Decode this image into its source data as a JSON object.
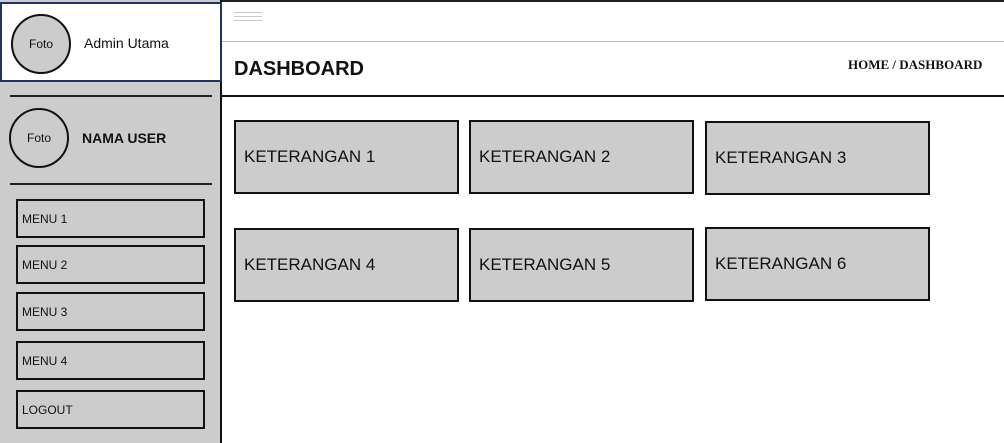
{
  "brand": {
    "avatar_text": "Foto",
    "name": "Admin Utama"
  },
  "user": {
    "avatar_text": "Foto",
    "name": "NAMA USER"
  },
  "sidebar": {
    "menu": [
      {
        "label": "MENU 1"
      },
      {
        "label": "MENU 2"
      },
      {
        "label": "MENU 3"
      },
      {
        "label": "MENU 4"
      },
      {
        "label": "LOGOUT"
      }
    ]
  },
  "header": {
    "title": "DASHBOARD",
    "breadcrumb": "HOME / DASHBOARD"
  },
  "cards": [
    {
      "label": "KETERANGAN 1"
    },
    {
      "label": "KETERANGAN 2"
    },
    {
      "label": "KETERANGAN 3"
    },
    {
      "label": "KETERANGAN 4"
    },
    {
      "label": "KETERANGAN 5"
    },
    {
      "label": "KETERANGAN 6"
    }
  ],
  "colors": {
    "panel": "#cccccc",
    "border": "#111111",
    "brand_border": "#203266"
  }
}
